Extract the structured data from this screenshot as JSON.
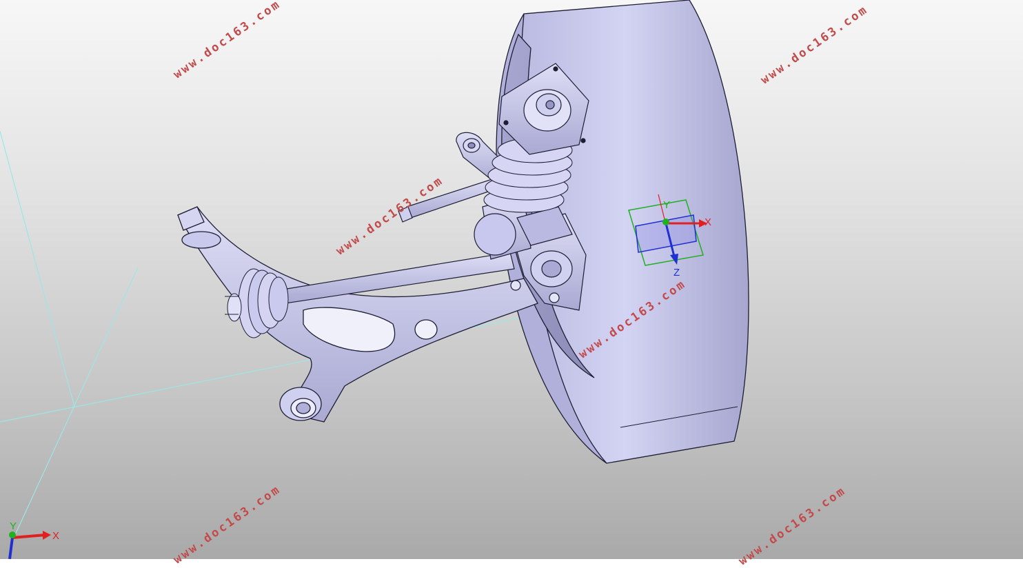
{
  "watermark": {
    "text": "www.doc163.com",
    "color": "#c24a4a"
  },
  "manipulator": {
    "x_label": "X",
    "y_label": "Y",
    "z_label": "Z"
  },
  "triad": {
    "x_label": "X",
    "y_label": "Y"
  },
  "colors": {
    "part_fill": "#c6c6ea",
    "part_shadow": "#9a9ac4",
    "edge": "#1d1d33",
    "axis_x": "#e02020",
    "axis_y": "#20b020",
    "axis_z": "#2030d0",
    "grid_line": "#9de6e6"
  }
}
